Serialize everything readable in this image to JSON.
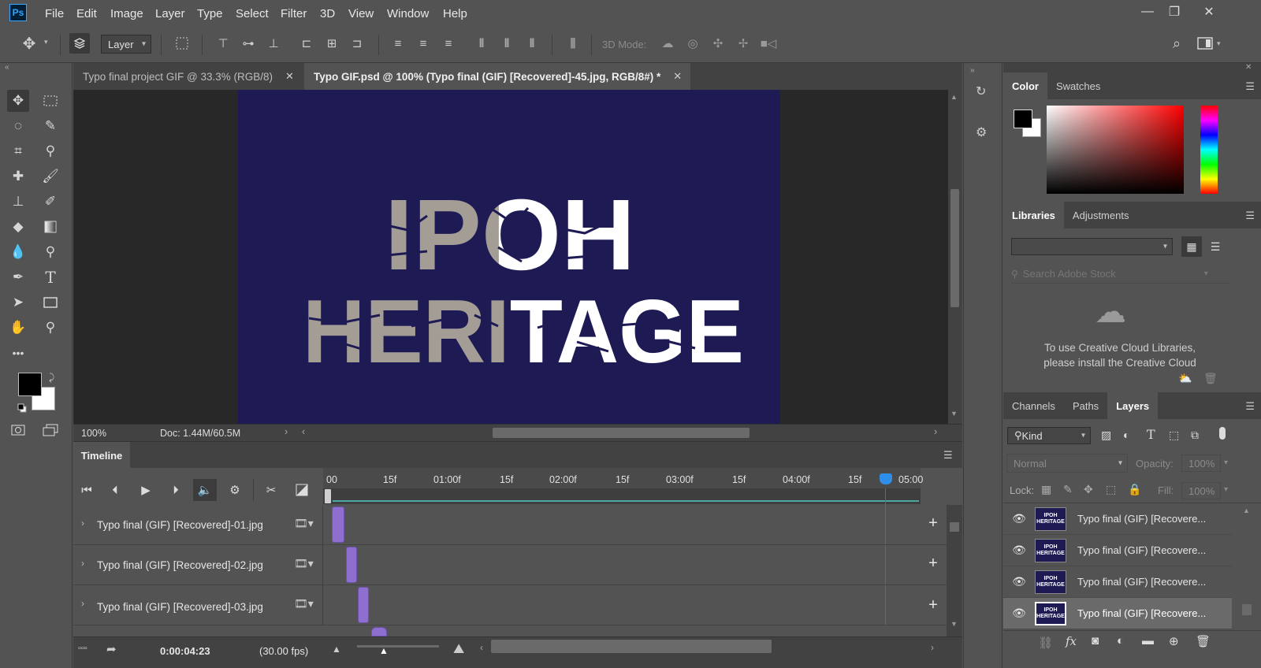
{
  "app": {
    "logo": "Ps"
  },
  "menu": [
    "File",
    "Edit",
    "Image",
    "Layer",
    "Type",
    "Select",
    "Filter",
    "3D",
    "View",
    "Window",
    "Help"
  ],
  "options_bar": {
    "auto_select_target": "Layer",
    "mode_3d_label": "3D Mode:"
  },
  "tabs": [
    {
      "label": "Typo final project GIF @ 33.3% (RGB/8)",
      "active": false
    },
    {
      "label": "Typo GIF.psd @ 100% (Typo final (GIF) [Recovered]-45.jpg, RGB/8#) *",
      "active": true
    }
  ],
  "canvas": {
    "line1": "IPOH",
    "line2": "HERITAGE",
    "background": "#1e1b54",
    "fade_color": "#a39d96",
    "text_color": "#ffffff"
  },
  "status": {
    "zoom": "100%",
    "doc_info": "Doc: 1.44M/60.5M"
  },
  "timeline": {
    "title": "Timeline",
    "ticks": [
      "00",
      "15f",
      "01:00f",
      "15f",
      "02:00f",
      "15f",
      "03:00f",
      "15f",
      "04:00f",
      "15f",
      "05:00"
    ],
    "tracks": [
      {
        "name": "Typo final (GIF) [Recovered]-01.jpg"
      },
      {
        "name": "Typo final (GIF) [Recovered]-02.jpg"
      },
      {
        "name": "Typo final (GIF) [Recovered]-03.jpg"
      }
    ],
    "current_time": "0:00:04:23",
    "fps": "(30.00 fps)",
    "clip_color": "#8e6fd0"
  },
  "color_panel": {
    "tabs": [
      "Color",
      "Swatches"
    ],
    "foreground": "#000000",
    "background": "#ffffff"
  },
  "libraries_panel": {
    "tabs": [
      "Libraries",
      "Adjustments"
    ],
    "search_placeholder": "Search Adobe Stock",
    "message_line1": "To use Creative Cloud Libraries,",
    "message_line2": "please install the Creative Cloud"
  },
  "layers_panel": {
    "tabs": [
      "Channels",
      "Paths",
      "Layers"
    ],
    "filter_kind": "Kind",
    "blend_mode": "Normal",
    "opacity_label": "Opacity:",
    "opacity_value": "100%",
    "lock_label": "Lock:",
    "fill_label": "Fill:",
    "fill_value": "100%",
    "layers": [
      {
        "name": "Typo final (GIF) [Recovere...",
        "selected": false
      },
      {
        "name": "Typo final (GIF) [Recovere...",
        "selected": false
      },
      {
        "name": "Typo final (GIF) [Recovere...",
        "selected": false
      },
      {
        "name": "Typo final (GIF) [Recovere...",
        "selected": true
      }
    ],
    "thumb_line1": "IPOH",
    "thumb_line2": "HERITAGE"
  }
}
